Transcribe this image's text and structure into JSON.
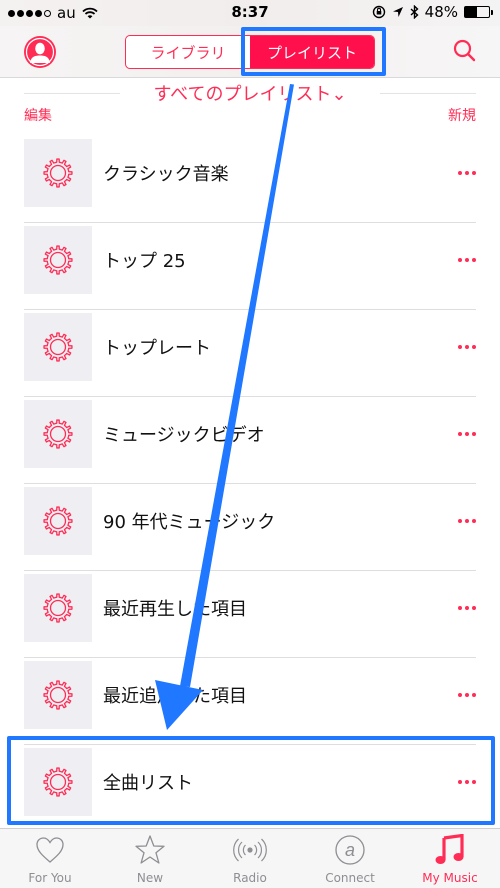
{
  "status_bar": {
    "signal_bars_filled": 4,
    "signal_bars_total": 5,
    "carrier": "au",
    "time": "8:37",
    "battery_text": "48%",
    "battery_level": 0.48,
    "icons": [
      "wifi-icon",
      "rotation-lock-icon",
      "location-icon",
      "bluetooth-icon",
      "battery-icon"
    ]
  },
  "nav": {
    "segments": [
      {
        "label": "ライブラリ",
        "active": false
      },
      {
        "label": "プレイリスト",
        "active": true
      }
    ],
    "profile_icon": "profile-icon",
    "search_icon": "search-icon"
  },
  "filter": {
    "title": "すべてのプレイリスト⌄"
  },
  "actions": {
    "edit": "編集",
    "new": "新規"
  },
  "playlists": [
    {
      "title": "クラシック音楽",
      "icon": "gear-icon"
    },
    {
      "title": "トップ 25",
      "icon": "gear-icon"
    },
    {
      "title": "トップレート",
      "icon": "gear-icon"
    },
    {
      "title": "ミュージックビデオ",
      "icon": "gear-icon"
    },
    {
      "title": "90 年代ミュージック",
      "icon": "gear-icon"
    },
    {
      "title": "最近再生した項目",
      "icon": "gear-icon"
    },
    {
      "title": "最近追加した項目",
      "icon": "gear-icon"
    },
    {
      "title": "全曲リスト",
      "icon": "gear-icon"
    }
  ],
  "tabbar": [
    {
      "label": "For You",
      "icon": "heart-icon",
      "active": false
    },
    {
      "label": "New",
      "icon": "star-icon",
      "active": false
    },
    {
      "label": "Radio",
      "icon": "radio-icon",
      "active": false
    },
    {
      "label": "Connect",
      "icon": "at-icon",
      "active": false
    },
    {
      "label": "My Music",
      "icon": "music-note-icon",
      "active": true
    }
  ],
  "colors": {
    "accent": "#ff2d55",
    "segment_active": "#ff0f4b",
    "annotation_blue": "#1f78ff",
    "inactive_tab": "#8e8e93"
  }
}
